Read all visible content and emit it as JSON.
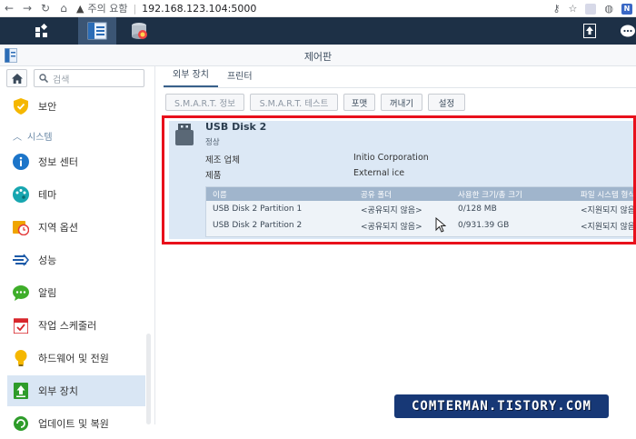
{
  "browser": {
    "security_label": "주의 요함",
    "url": "192.168.123.104:5000"
  },
  "window": {
    "title": "제어판"
  },
  "sidebar": {
    "search_placeholder": "검색",
    "section_label": "시스템",
    "items": [
      {
        "label": "보안",
        "icon": "shield-icon"
      },
      {
        "label": "정보 센터",
        "icon": "info-icon"
      },
      {
        "label": "테마",
        "icon": "palette-icon"
      },
      {
        "label": "지역 옵션",
        "icon": "clock-calendar-icon"
      },
      {
        "label": "성능",
        "icon": "performance-icon"
      },
      {
        "label": "알림",
        "icon": "chat-bubble-icon"
      },
      {
        "label": "작업 스케줄러",
        "icon": "calendar-check-icon"
      },
      {
        "label": "하드웨어 및 전원",
        "icon": "lightbulb-icon"
      },
      {
        "label": "외부 장치",
        "icon": "upload-icon"
      },
      {
        "label": "업데이트 및 복원",
        "icon": "update-icon"
      }
    ]
  },
  "tabs": [
    {
      "label": "외부 장치",
      "active": true
    },
    {
      "label": "프린터",
      "active": false
    }
  ],
  "toolbar": {
    "smart_info": "S.M.A.R.T. 정보",
    "smart_test": "S.M.A.R.T. 테스트",
    "format": "포맷",
    "eject": "꺼내기",
    "settings": "설정"
  },
  "device": {
    "name": "USB Disk 2",
    "status": "정상",
    "manufacturer_label": "제조 업체",
    "manufacturer_value": "Initio Corporation",
    "product_label": "제품",
    "product_value": "External ice"
  },
  "partition_table": {
    "headers": [
      "이름",
      "공유 폴더",
      "사용한 크기/총 크기",
      "파일 시스템 형식"
    ],
    "rows": [
      [
        "USB Disk 2 Partition 1",
        "<공유되지 않음>",
        "0/128 MB",
        "<지원되지 않음>"
      ],
      [
        "USB Disk 2 Partition 2",
        "<공유되지 않음>",
        "0/931.39 GB",
        "<지원되지 않음>"
      ]
    ]
  },
  "watermark": "COMTERMAN.TISTORY.COM",
  "colors": {
    "taskbar": "#1d3046",
    "panel_bg": "#dce8f5",
    "highlight_frame": "#e8101b",
    "active_nav": "#d9e6f4"
  }
}
